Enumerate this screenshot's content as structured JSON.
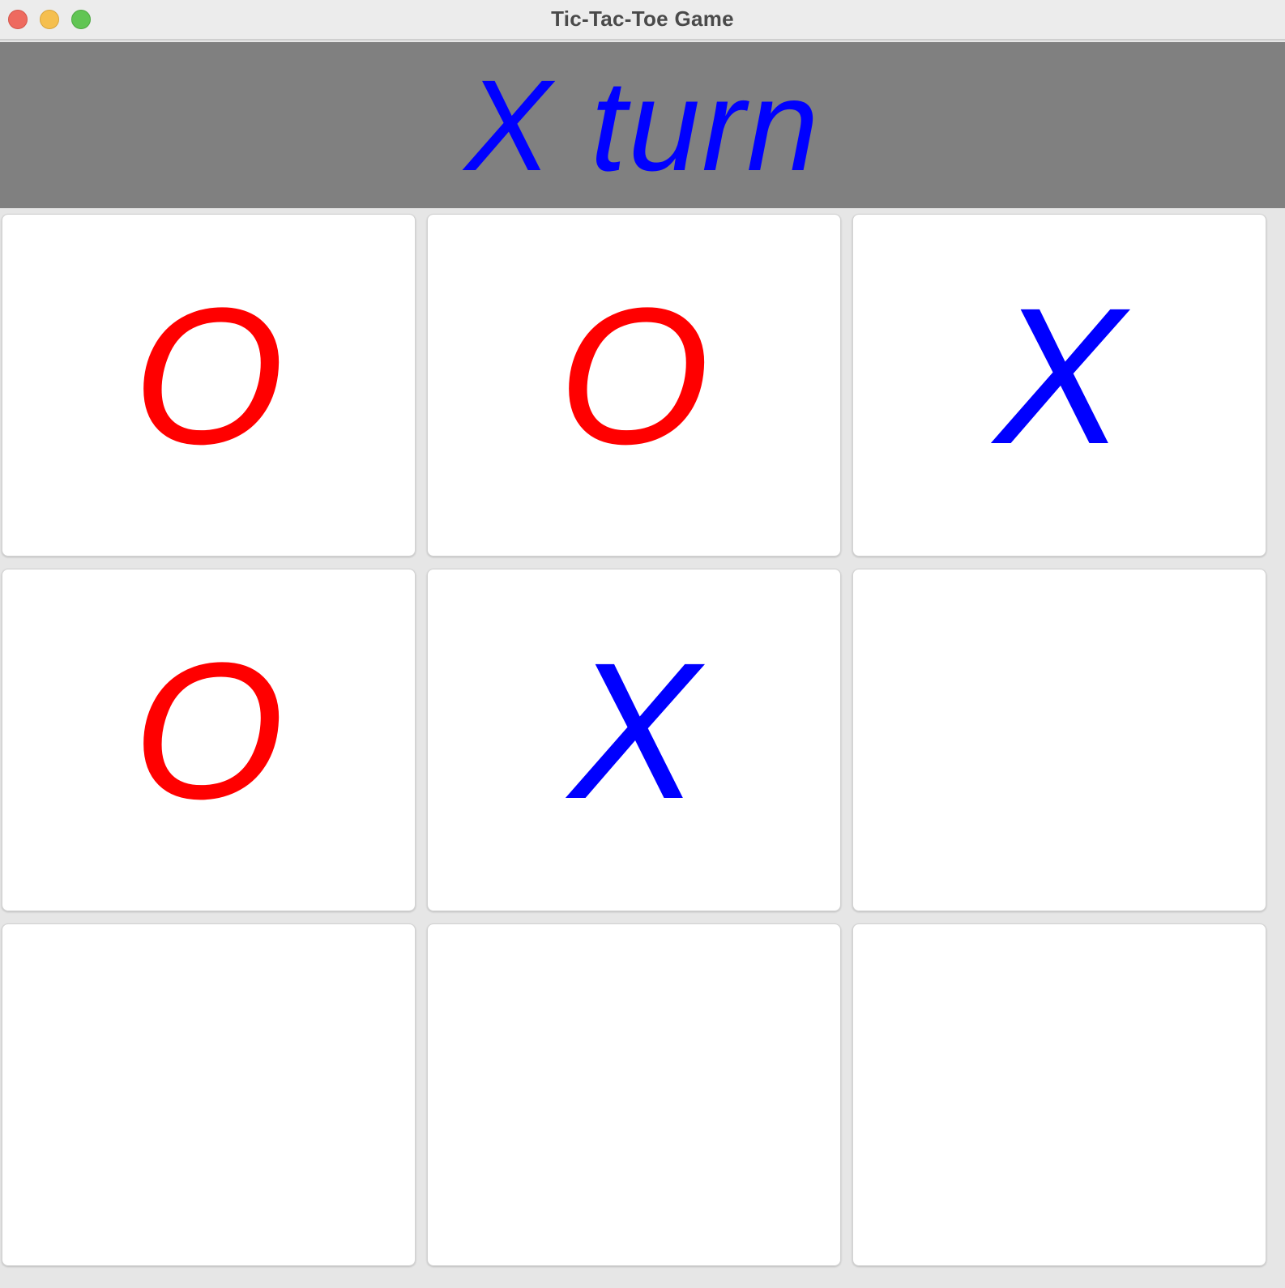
{
  "window": {
    "title": "Tic-Tac-Toe Game"
  },
  "status": {
    "text": "X turn",
    "color": "#0000ff"
  },
  "colors": {
    "x": "#0000ff",
    "o": "#ff0000",
    "status_bar_bg": "#808080"
  },
  "board": {
    "cells": [
      "O",
      "O",
      "X",
      "O",
      "X",
      "",
      "",
      "",
      ""
    ]
  }
}
